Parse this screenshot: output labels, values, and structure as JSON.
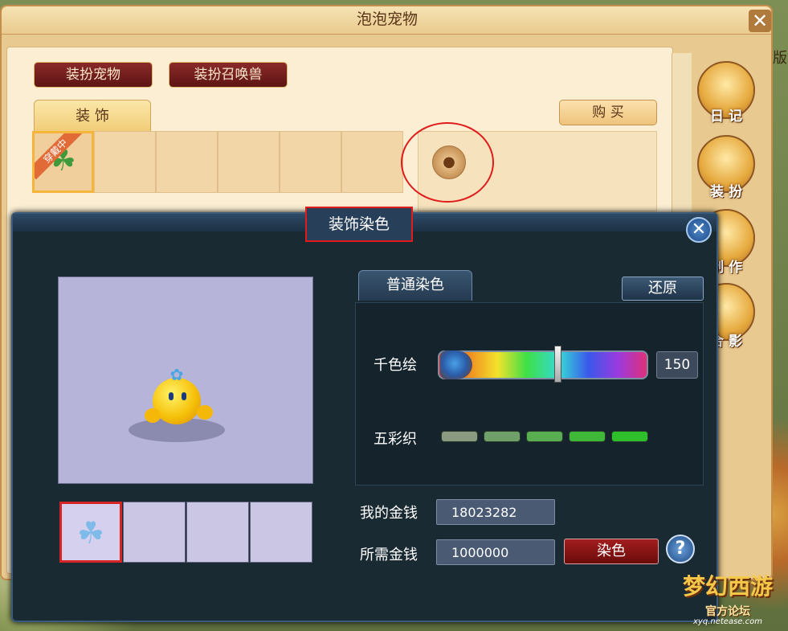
{
  "window": {
    "title": "泡泡宠物",
    "close_glyph": "✕"
  },
  "top_buttons": {
    "dress_pet": "装扮宠物",
    "dress_summon": "装扮召唤兽"
  },
  "decor_tab": "装 饰",
  "buy_button": "购 买",
  "grid": {
    "wearing_badge": "穿戴中"
  },
  "side_menu": [
    {
      "label": "日 记",
      "icon": "diary-icon"
    },
    {
      "label": "装 扮",
      "icon": "pinwheel-icon"
    },
    {
      "label": "制 作",
      "icon": "craft-icon"
    },
    {
      "label": "合 影",
      "icon": "photo-icon"
    }
  ],
  "right_edge_char": "版",
  "dye_dialog": {
    "title": "装饰染色",
    "close_glyph": "✕",
    "tab_label": "普通染色",
    "restore_label": "还原",
    "hue_label": "千色绘",
    "hue_value": "150",
    "hue_fraction": 0.57,
    "five_color_label": "五彩织",
    "five_colors": [
      "#8a9a80",
      "#6fa06a",
      "#5aae52",
      "#3fb83a",
      "#2ec02a"
    ],
    "my_money_label": "我的金钱",
    "my_money_value": "18023282",
    "need_money_label": "所需金钱",
    "need_money_value": "1000000",
    "dye_button": "染色",
    "help_glyph": "?"
  },
  "logo": {
    "main": "梦幻西游",
    "sub": "官方论坛",
    "url": "xyq.netease.com"
  },
  "colors": {
    "accent_red": "#e01b1b",
    "window_bg": "#e8c98f",
    "dialog_bg": "#1a2a33"
  }
}
